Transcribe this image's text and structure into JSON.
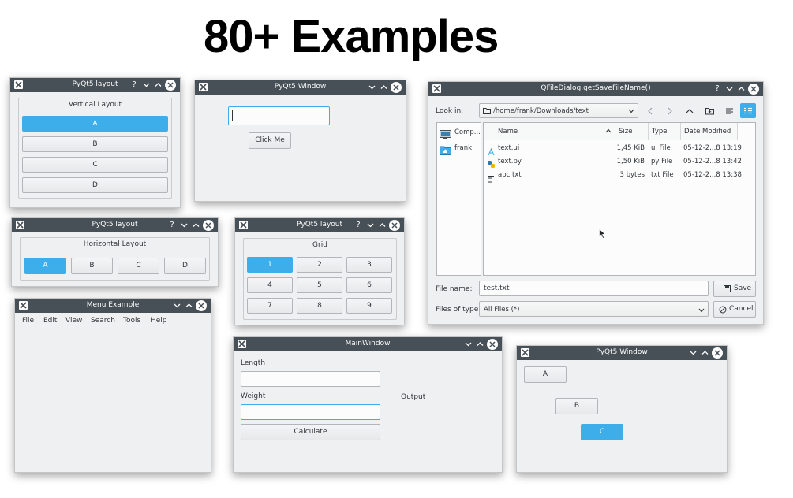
{
  "headline": "80+ Examples",
  "windows": {
    "vlayout": {
      "title": "PyQt5 layout",
      "group_title": "Vertical Layout",
      "buttons": [
        "A",
        "B",
        "C",
        "D"
      ]
    },
    "pyqt_window": {
      "title": "PyQt5 Window",
      "input_value": "",
      "button": "Click Me"
    },
    "file_dialog": {
      "title": "QFileDialog.getSaveFileName()",
      "look_in_label": "Look in:",
      "path": "/home/frank/Downloads/text",
      "places": [
        "Comp...",
        "frank"
      ],
      "columns": [
        "Name",
        "Size",
        "Type",
        "Date Modified"
      ],
      "files": [
        {
          "name": "text.ui",
          "size": "1,45 KiB",
          "type": "ui File",
          "date": "05-12-2...8 13:19"
        },
        {
          "name": "text.py",
          "size": "1,50 KiB",
          "type": "py File",
          "date": "05-12-2...8 13:42"
        },
        {
          "name": "abc.txt",
          "size": "3 bytes",
          "type": "txt File",
          "date": "05-12-2...8 13:38"
        }
      ],
      "filename_label": "File name:",
      "filename_value": "test.txt",
      "save_label": "Save",
      "filetype_label": "Files of type:",
      "filetype_value": "All Files (*)",
      "cancel_label": "Cancel"
    },
    "hlayout": {
      "title": "PyQt5 layout",
      "group_title": "Horizontal Layout",
      "buttons": [
        "A",
        "B",
        "C",
        "D"
      ]
    },
    "grid": {
      "title": "PyQt5 layout",
      "group_title": "Grid",
      "buttons": [
        "1",
        "2",
        "3",
        "4",
        "5",
        "6",
        "7",
        "8",
        "9"
      ]
    },
    "menu": {
      "title": "Menu Example",
      "items": [
        "File",
        "Edit",
        "View",
        "Search",
        "Tools",
        "Help"
      ]
    },
    "main": {
      "title": "MainWindow",
      "length_label": "Length",
      "weight_label": "Weight",
      "output_label": "Output",
      "calculate_label": "Calculate",
      "length_value": "",
      "weight_value": ""
    },
    "abc": {
      "title": "PyQt5 Window",
      "buttons": [
        "A",
        "B",
        "C"
      ]
    }
  },
  "colors": {
    "titlebar": "#475057",
    "accent": "#3daee9",
    "window_bg": "#eff0f1"
  }
}
